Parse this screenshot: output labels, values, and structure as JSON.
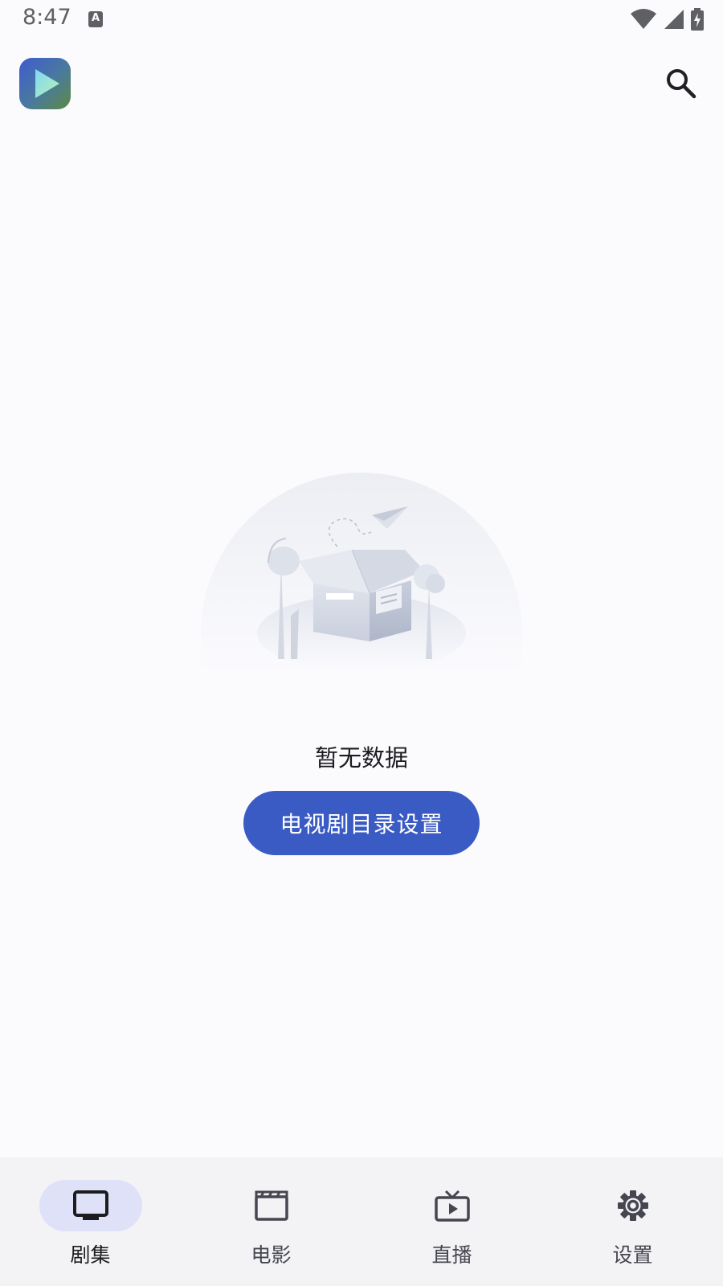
{
  "status_bar": {
    "time": "8:47",
    "notification_icon": "a-letter-icon",
    "icons": [
      "wifi-icon",
      "signal-icon",
      "battery-charging-icon"
    ]
  },
  "app_bar": {
    "logo_icon": "play-logo-icon",
    "search_icon": "search-icon"
  },
  "empty_state": {
    "illustration": "empty-box-illustration",
    "message": "暂无数据",
    "action_label": "电视剧目录设置"
  },
  "bottom_nav": {
    "items": [
      {
        "label": "剧集",
        "icon": "tv-icon",
        "active": true
      },
      {
        "label": "电影",
        "icon": "clapperboard-icon",
        "active": false
      },
      {
        "label": "直播",
        "icon": "live-tv-icon",
        "active": false
      },
      {
        "label": "设置",
        "icon": "gear-icon",
        "active": false
      }
    ]
  },
  "colors": {
    "background": "#fbfbfe",
    "accent": "#3a5ac4",
    "nav_background": "#f3f3f6",
    "nav_active_pill": "#dfe1f9"
  }
}
